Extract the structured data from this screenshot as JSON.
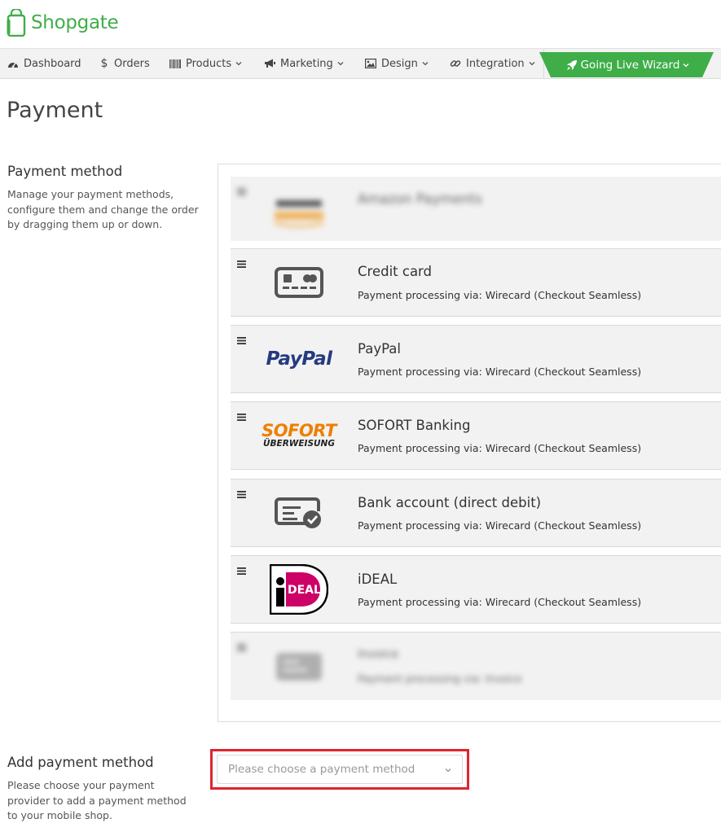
{
  "app": {
    "brand": "Shopgate"
  },
  "nav": {
    "items": [
      {
        "label": "Dashboard",
        "icon": "dashboard-icon"
      },
      {
        "label": "Orders",
        "icon": "dollar-icon"
      },
      {
        "label": "Products",
        "icon": "barcode-icon"
      },
      {
        "label": "Marketing",
        "icon": "bullhorn-icon"
      },
      {
        "label": "Design",
        "icon": "picture-icon"
      },
      {
        "label": "Integration",
        "icon": "link-icon"
      }
    ],
    "wizard": {
      "label": "Going Live Wizard",
      "icon": "rocket-icon",
      "color": "#3fae49"
    }
  },
  "page": {
    "title": "Payment"
  },
  "payment_methods": {
    "title": "Payment method",
    "description": "Manage your payment methods, configure them and change the order by dragging them up or down.",
    "items": [
      {
        "name": "Amazon Payments",
        "via": "",
        "logo": "amazon-payments-logo",
        "blurred": true
      },
      {
        "name": "Credit card",
        "via": "Payment processing via: Wirecard (Checkout Seamless)",
        "logo": "credit-card-icon",
        "blurred": false
      },
      {
        "name": "PayPal",
        "via": "Payment processing via: Wirecard (Checkout Seamless)",
        "logo": "paypal-logo",
        "logo_text": "PayPal",
        "blurred": false
      },
      {
        "name": "SOFORT Banking",
        "via": "Payment processing via: Wirecard (Checkout Seamless)",
        "logo": "sofort-logo",
        "logo_text": "SOFORT",
        "logo_subtext": "ÜBERWEISUNG",
        "blurred": false
      },
      {
        "name": "Bank account (direct debit)",
        "via": "Payment processing via: Wirecard (Checkout Seamless)",
        "logo": "direct-debit-icon",
        "blurred": false
      },
      {
        "name": "iDEAL",
        "via": "Payment processing via: Wirecard (Checkout Seamless)",
        "logo": "ideal-logo",
        "logo_text": "iDEAL",
        "blurred": false
      },
      {
        "name": "Invoice",
        "via": "Payment processing via: Invoice",
        "logo": "invoice-icon",
        "blurred": true
      }
    ]
  },
  "add_payment": {
    "title": "Add payment method",
    "description": "Please choose your payment provider to add a payment method to your mobile shop.",
    "placeholder": "Please choose a payment method",
    "highlight_color": "#e1232e"
  }
}
